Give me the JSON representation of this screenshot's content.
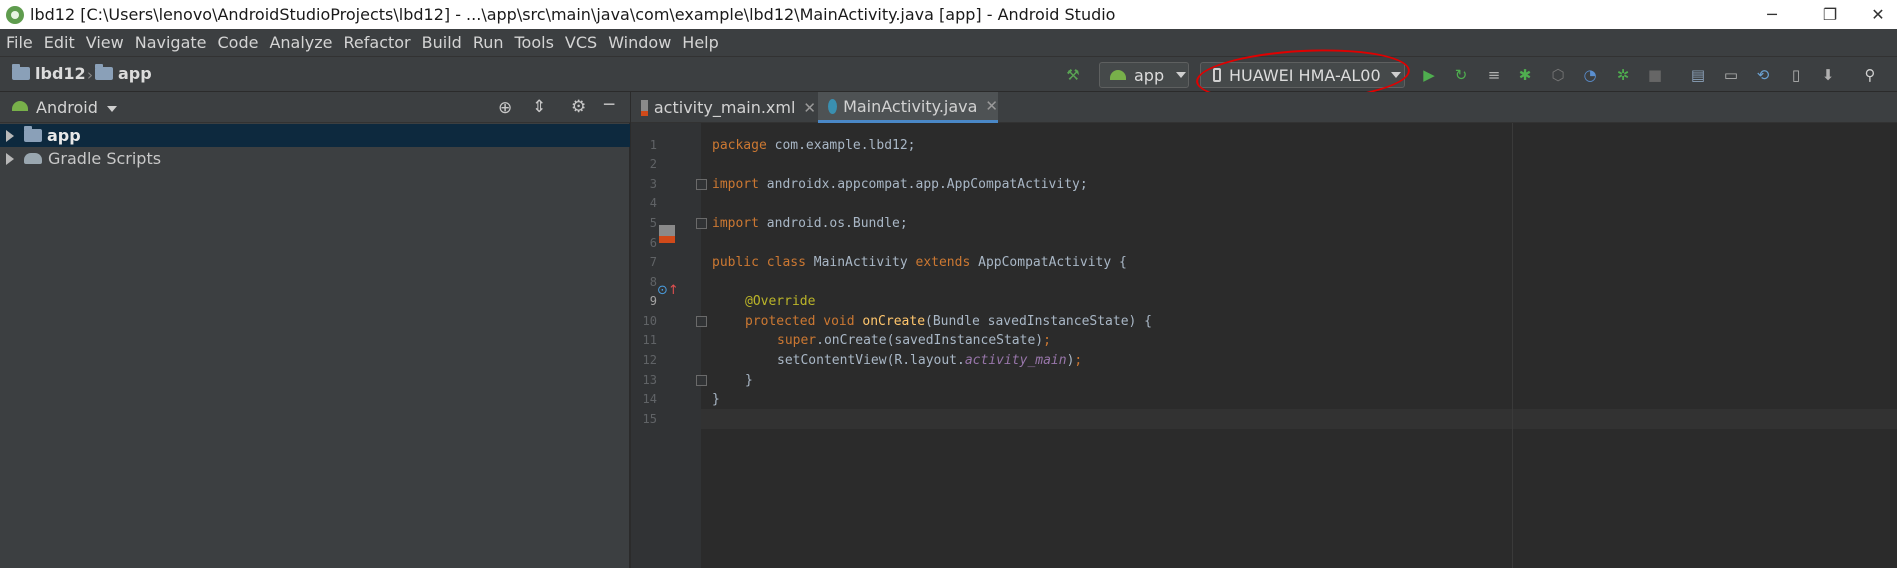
{
  "window": {
    "title": "lbd12 [C:\\Users\\lenovo\\AndroidStudioProjects\\lbd12] - ...\\app\\src\\main\\java\\com\\example\\lbd12\\MainActivity.java [app] - Android Studio",
    "minimize": "─",
    "maximize": "❐",
    "close": "✕"
  },
  "menu": {
    "items": [
      {
        "label": "File"
      },
      {
        "label": "Edit"
      },
      {
        "label": "View"
      },
      {
        "label": "Navigate"
      },
      {
        "label": "Code"
      },
      {
        "label": "Analyze"
      },
      {
        "label": "Refactor"
      },
      {
        "label": "Build"
      },
      {
        "label": "Run"
      },
      {
        "label": "Tools"
      },
      {
        "label": "VCS"
      },
      {
        "label": "Window"
      },
      {
        "label": "Help"
      }
    ]
  },
  "breadcrumb": {
    "project": "lbd12",
    "module": "app"
  },
  "toolbar": {
    "run_config": "app",
    "device": "HUAWEI HMA-AL00"
  },
  "project_panel": {
    "view": "Android",
    "tree": [
      {
        "label": "app",
        "selected": true
      },
      {
        "label": "Gradle Scripts",
        "selected": false
      }
    ]
  },
  "editor": {
    "tabs": [
      {
        "label": "activity_main.xml",
        "active": false
      },
      {
        "label": "MainActivity.java",
        "active": true
      }
    ],
    "line_numbers": [
      "1",
      "2",
      "3",
      "4",
      "5",
      "6",
      "7",
      "8",
      "9",
      "10",
      "11",
      "12",
      "13",
      "14",
      "15"
    ],
    "code": {
      "l1_kw": "package",
      "l1_rest": " com.example.lbd12;",
      "l3_kw": "import",
      "l3_rest": " androidx.appcompat.app.AppCompatActivity;",
      "l5_kw": "import",
      "l5_rest": " android.os.Bundle;",
      "l7_kw1": "public class",
      "l7_name": " MainActivity ",
      "l7_kw2": "extends",
      "l7_rest": " AppCompatActivity {",
      "l9_ann": "@Override",
      "l10_kw": "protected void",
      "l10_mth": " onCreate",
      "l10_rest": "(Bundle savedInstanceState) {",
      "l11_kw": "super",
      "l11_rest": ".onCreate(savedInstanceState)",
      "l11_semi": ";",
      "l12_pre": "setContentView(R.layout.",
      "l12_fld": "activity_main",
      "l12_post": ")",
      "l12_semi": ";",
      "l13": "}",
      "l14": "}"
    }
  }
}
